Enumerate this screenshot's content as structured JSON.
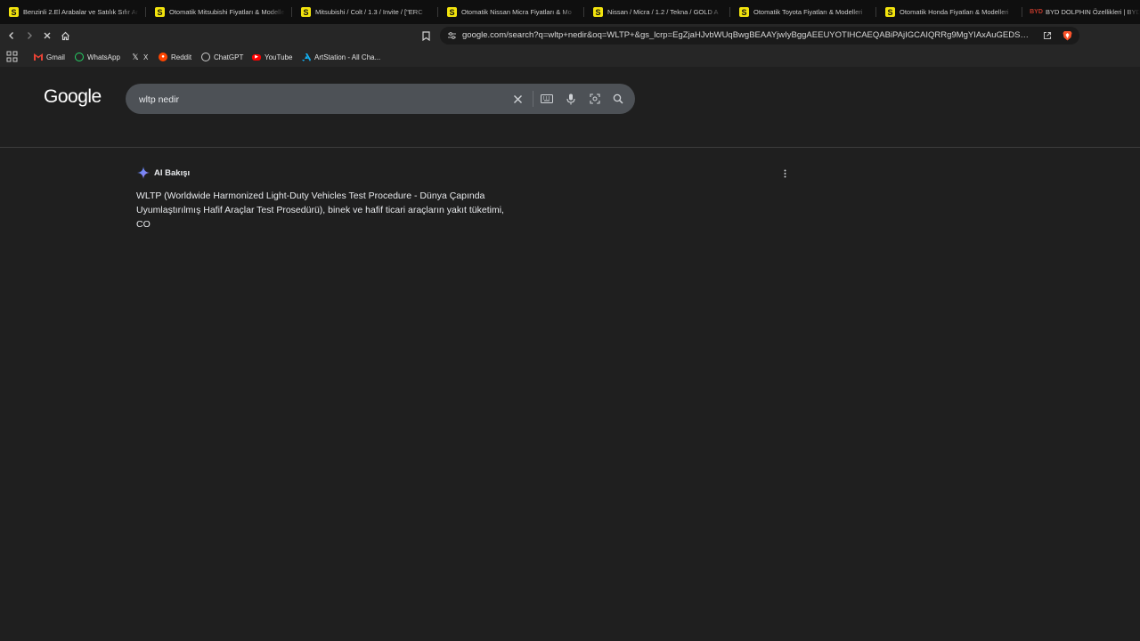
{
  "tabs": [
    {
      "title": "Benzinli 2.El Arabalar ve Satılık Sıfır Ar",
      "favicon": "S"
    },
    {
      "title": "Otomatik Mitsubishi Fiyatları & Modelleri",
      "favicon": "S"
    },
    {
      "title": "Mitsubishi / Colt / 1.3 / Invite / [\"ERC",
      "favicon": "S"
    },
    {
      "title": "Otomatik Nissan Micra Fiyatları & Mo",
      "favicon": "S"
    },
    {
      "title": "Nissan / Micra / 1.2 / Tekna / GOLD A",
      "favicon": "S"
    },
    {
      "title": "Otomatik Toyota Fiyatları & Modelleri",
      "favicon": "S"
    },
    {
      "title": "Otomatik Honda Fiyatları & Modelleri",
      "favicon": "S"
    },
    {
      "title": "BYD DOLPHIN Özellikleri | BYD",
      "favicon": "BYD"
    }
  ],
  "omnibox": {
    "url": "google.com/search?q=wltp+nedir&oq=WLTP+&gs_lcrp=EgZjaHJvbWUqBwgBEAAYjwIyBggAEEUYOTIHCAEQABiPAjIGCAIQRRg9MgYIAxAuGEDSAQgyMTA..."
  },
  "bookmarks": [
    {
      "label": "Gmail",
      "icon": "gmail-icon",
      "color": "#ea4335"
    },
    {
      "label": "WhatsApp",
      "icon": "whatsapp-icon",
      "color": "#25d366"
    },
    {
      "label": "X",
      "icon": "x-icon",
      "color": "#ffffff"
    },
    {
      "label": "Reddit",
      "icon": "reddit-icon",
      "color": "#ff4500"
    },
    {
      "label": "ChatGPT",
      "icon": "chatgpt-icon",
      "color": "#cccccc"
    },
    {
      "label": "YouTube",
      "icon": "youtube-icon",
      "color": "#ff0000"
    },
    {
      "label": "ArtStation - All Cha...",
      "icon": "artstation-icon",
      "color": "#13aff0"
    }
  ],
  "google": {
    "logo": "Google",
    "query": "wltp nedir"
  },
  "ai_overview": {
    "label": "AI Bakışı",
    "text": "WLTP (Worldwide Harmonized Light-Duty Vehicles Test Procedure - Dünya Çapında Uyumlaştırılmış Hafif Araçlar Test Prosedürü), binek ve hafif ticari araçların yakıt tüketimi, CO"
  }
}
